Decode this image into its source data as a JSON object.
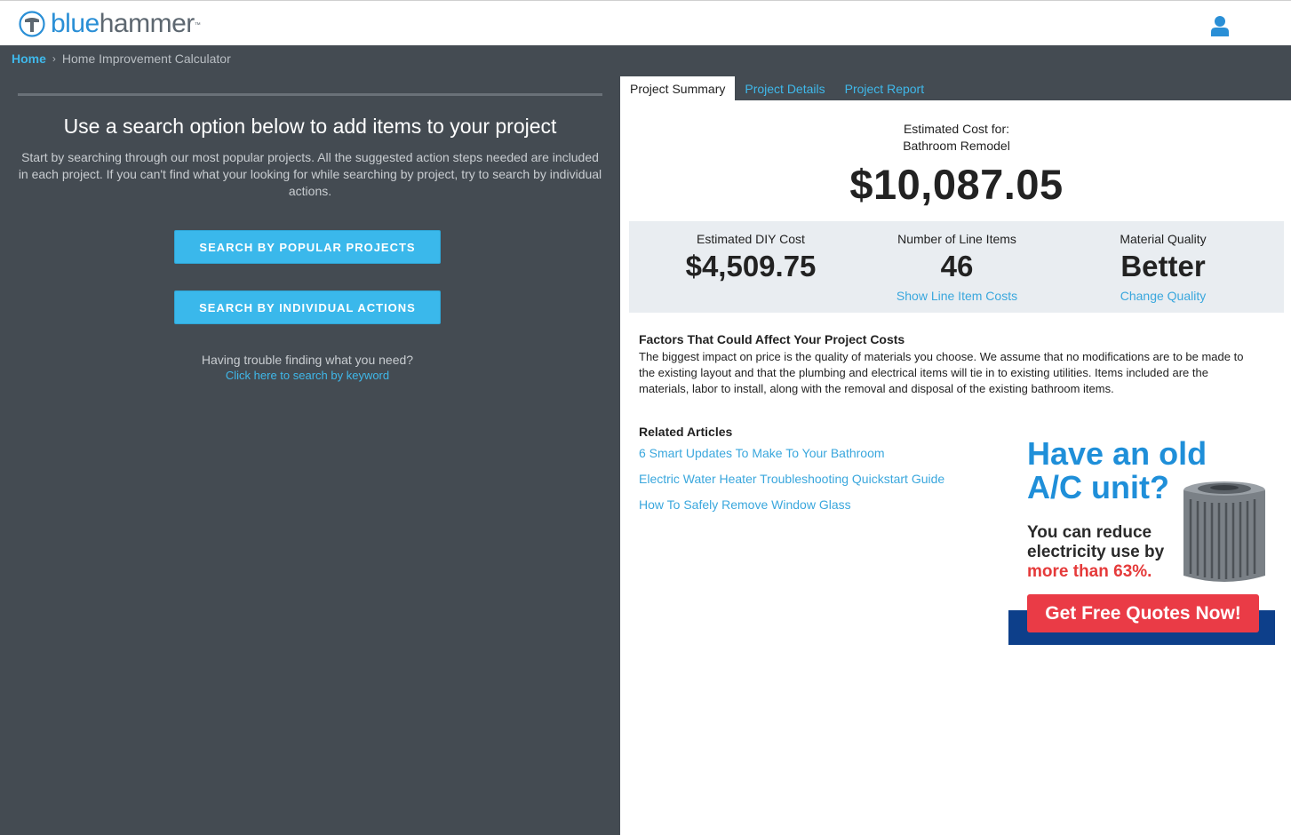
{
  "header": {
    "logo_blue": "blue",
    "logo_gray": "hammer",
    "logo_tm": "™",
    "user_icon": "user-icon"
  },
  "breadcrumb": {
    "home": "Home",
    "current": "Home Improvement Calculator"
  },
  "search": {
    "title": "Use a search option below to add items to your project",
    "description": "Start by searching through our most popular projects. All the suggested action steps needed are included in each project. If you can't find what your looking for while searching by project, try to search by individual actions.",
    "popular_button": "SEARCH BY POPULAR PROJECTS",
    "actions_button": "SEARCH BY INDIVIDUAL ACTIONS",
    "trouble_text": "Having trouble finding what you need?",
    "keyword_link": "Click here to search by keyword"
  },
  "tabs": [
    {
      "label": "Project Summary",
      "active": true
    },
    {
      "label": "Project Details",
      "active": false
    },
    {
      "label": "Project Report",
      "active": false
    }
  ],
  "summary": {
    "estimate_label": "Estimated Cost for:",
    "project_name": "Bathroom Remodel",
    "total_cost": "$10,087.05",
    "diy_label": "Estimated DIY Cost",
    "diy_cost": "$4,509.75",
    "line_items_label": "Number of Line Items",
    "line_items_count": "46",
    "line_items_link": "Show Line Item Costs",
    "quality_label": "Material Quality",
    "quality_value": "Better",
    "quality_link": "Change Quality"
  },
  "factors": {
    "title": "Factors That Could Affect Your Project Costs",
    "text": "The biggest impact on price is the quality of materials you choose. We assume that no modifications are to be made to the existing layout and that the plumbing and electrical items will tie in to existing utilities. Items included are the materials, labor to install, along with the removal and disposal of the existing bathroom items."
  },
  "related": {
    "title": "Related Articles",
    "articles": [
      "6 Smart Updates To Make To Your Bathroom",
      "Electric Water Heater Troubleshooting Quickstart Guide",
      "How To Safely Remove Window Glass"
    ]
  },
  "ad": {
    "headline_1": "Have an old",
    "headline_2": "A/C unit?",
    "sub_1": "You can reduce",
    "sub_2": "electricity use by",
    "sub_3": "more than 63%.",
    "cta": "Get Free Quotes Now!"
  },
  "colors": {
    "accent": "#3ab8eb",
    "link": "#3aa7dd",
    "panel_dark": "#444b52",
    "ad_blue": "#1f8fd9",
    "ad_red": "#ea3b46"
  }
}
